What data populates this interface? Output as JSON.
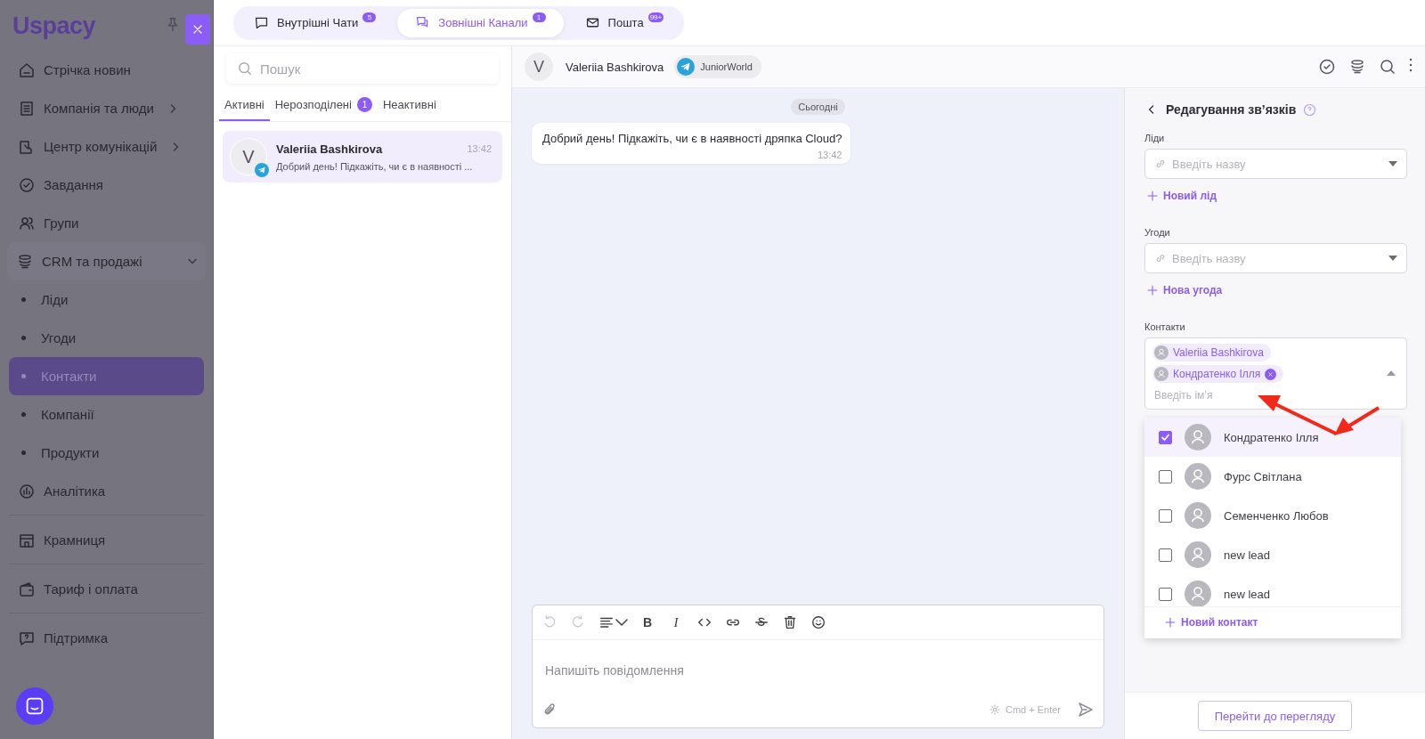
{
  "sidebar": {
    "logo": "Uspacy",
    "items": [
      {
        "label": "Стрічка новин",
        "selected": false
      },
      {
        "label": "Компанія та люди",
        "selected": false,
        "expanded": false
      },
      {
        "label": "Центр комунікацій",
        "selected": false,
        "expanded": false
      },
      {
        "label": "Завдання",
        "selected": false
      },
      {
        "label": "Групи",
        "selected": false
      },
      {
        "label": "CRM та продажі",
        "selected": false,
        "expanded": true,
        "children": [
          {
            "label": "Ліди",
            "selected": false
          },
          {
            "label": "Угоди",
            "selected": false
          },
          {
            "label": "Контакти",
            "selected": true
          },
          {
            "label": "Компанії",
            "selected": false
          },
          {
            "label": "Продукти",
            "selected": false
          }
        ]
      },
      {
        "label": "Аналітика",
        "selected": false,
        "divider_after": true
      },
      {
        "label": "Крамниця",
        "selected": false,
        "divider_after": true
      },
      {
        "label": "Тариф і оплата",
        "selected": false,
        "divider_after": true
      },
      {
        "label": "Підтримка",
        "selected": false
      }
    ]
  },
  "top_tabs": [
    {
      "label": "Внутрішні Чати",
      "badge": "5",
      "selected": false
    },
    {
      "label": "Зовнішні Канали",
      "badge": "1",
      "selected": true
    },
    {
      "label": "Пошта",
      "badge": "99+",
      "selected": false
    }
  ],
  "chat_list": {
    "search_placeholder": "Пошук",
    "tabs": [
      {
        "label": "Активні",
        "selected": true
      },
      {
        "label": "Нерозподілені",
        "badge": "1",
        "selected": false
      },
      {
        "label": "Неактивні",
        "selected": false
      }
    ],
    "chats": [
      {
        "initial": "V",
        "name": "Valeriia Bashkirova",
        "time": "13:42",
        "preview": "Добрий день! Підкажіть, чи є в наявності ...",
        "selected": true
      }
    ]
  },
  "chat": {
    "initial": "V",
    "name": "Valeriia Bashkirova",
    "channel": "JuniorWorld",
    "date": "Сьогодні",
    "messages": [
      {
        "text": "Добрий день! Підкажіть, чи є в наявності дряпка Cloud?",
        "time": "13:42"
      }
    ],
    "composer": {
      "bold_label": "B",
      "italic_label": "I",
      "placeholder": "Напишіть повідомлення",
      "hint": "Cmd + Enter"
    }
  },
  "links_panel": {
    "title": "Редагування зв’язків",
    "leads": {
      "label": "Ліди",
      "placeholder": "Введіть назву",
      "add": "Новий лід"
    },
    "deals": {
      "label": "Угоди",
      "placeholder": "Введіть назву",
      "add": "Нова угода"
    },
    "contacts": {
      "label": "Контакти",
      "chips": [
        {
          "name": "Valeriia Bashkirova",
          "removable": false
        },
        {
          "name": "Кондратенко Ілля",
          "removable": true
        }
      ],
      "placeholder": "Введіть ім’я",
      "options": [
        {
          "name": "Кондратенко Ілля",
          "checked": true,
          "selected": true
        },
        {
          "name": "Фурс Світлана",
          "checked": false,
          "selected": false
        },
        {
          "name": "Семенченко Любов",
          "checked": false,
          "selected": false
        },
        {
          "name": "new lead",
          "checked": false,
          "selected": false
        },
        {
          "name": "new lead",
          "checked": false,
          "selected": false
        }
      ],
      "add": "Новий контакт"
    },
    "footer_button": "Перейти до перегляду"
  }
}
